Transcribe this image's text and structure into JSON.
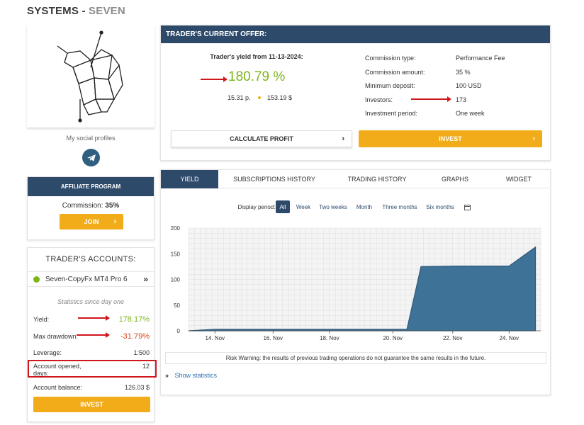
{
  "header": {
    "title_main": "SYSTEMS -",
    "title_sub": "SEVEN"
  },
  "profile": {
    "social_label": "My social profiles"
  },
  "affiliate": {
    "title": "AFFILIATE PROGRAM",
    "commission_label": "Commission:",
    "commission_value": "35%",
    "join_label": "JOIN"
  },
  "accounts": {
    "title": "TRADER'S ACCOUNTS:",
    "account_name": "Seven-CopyFx MT4 Pro 6",
    "stats_note": "Statistics since day one",
    "rows": [
      {
        "label": "Yield:",
        "value": "178.17%"
      },
      {
        "label": "Max drawdown:",
        "value": "-31.79%"
      },
      {
        "label": "Leverage:",
        "value": "1:500"
      },
      {
        "label": "Account opened, days:",
        "value": "12"
      },
      {
        "label": "Account balance:",
        "value": "126.03 $"
      }
    ],
    "invest_label": "INVEST"
  },
  "offer": {
    "title": "TRADER'S CURRENT OFFER:",
    "yield_from": "Trader's yield from 11-13-2024:",
    "yield_value": "180.79 %",
    "points": "15.31 p.",
    "money": "153.19 $",
    "details": [
      {
        "label": "Commission type:",
        "value": "Performance Fee"
      },
      {
        "label": "Commission amount:",
        "value": "35 %"
      },
      {
        "label": "Minimum deposit:",
        "value": "100 USD"
      },
      {
        "label": "Investors:",
        "value": "173"
      },
      {
        "label": "Investment period:",
        "value": "One week"
      }
    ],
    "calc_label": "CALCULATE PROFIT",
    "invest_label": "INVEST"
  },
  "tabs": [
    "YIELD",
    "SUBSCRIPTIONS HISTORY",
    "TRADING HISTORY",
    "GRAPHS",
    "WIDGET"
  ],
  "periods": {
    "label": "Display period:",
    "options": [
      "All",
      "Week",
      "Two weeks",
      "Month",
      "Three months",
      "Six months"
    ],
    "selected": "All"
  },
  "risk_warning": "Risk Warning: the results of previous trading operations do not guarantee the same results in the future.",
  "show_statistics": "Show statistics",
  "colors": {
    "navy": "#2e4a6b",
    "yellow": "#f2ac1a",
    "green": "#7cb518",
    "red": "#d9471b",
    "chart_fill": "#3e7296"
  },
  "icons": {
    "telegram": "telegram-icon",
    "calendar": "calendar-icon",
    "logo": "geometric-bull-logo"
  },
  "chart_data": {
    "type": "area",
    "x": [
      "13. Nov",
      "14. Nov",
      "15. Nov",
      "16. Nov",
      "17. Nov",
      "18. Nov",
      "19. Nov",
      "20. Nov",
      "20.5 Nov",
      "21. Nov",
      "22. Nov",
      "23. Nov",
      "24. Nov",
      "25. Nov"
    ],
    "values": [
      0,
      3,
      3,
      3,
      3,
      3,
      3,
      3,
      3,
      125,
      126,
      126,
      126,
      163
    ],
    "x_tick_labels": [
      "14. Nov",
      "16. Nov",
      "18. Nov",
      "20. Nov",
      "22. Nov",
      "24. Nov"
    ],
    "y_ticks": [
      0,
      50,
      100,
      150,
      200
    ],
    "ylim": [
      0,
      200
    ],
    "grid": true,
    "legend": "none"
  }
}
